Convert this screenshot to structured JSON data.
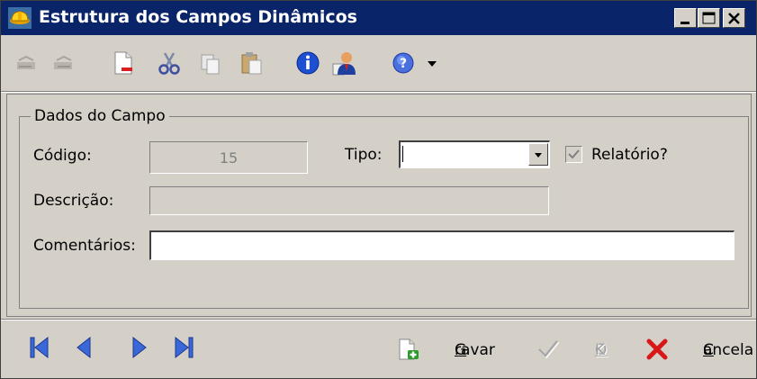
{
  "window": {
    "title": "Estrutura dos Campos Dinâmicos",
    "min_label": "minimize",
    "max_label": "maximize",
    "close_label": "close"
  },
  "toolbar": {
    "icons": [
      "undo-icon",
      "redo-icon",
      "new-document-icon",
      "cut-icon",
      "copy-icon",
      "paste-icon",
      "info-icon",
      "user-icon",
      "help-icon",
      "dropdown-arrow-icon"
    ]
  },
  "group": {
    "legend": "Dados do Campo"
  },
  "form": {
    "codigo_label": "Código:",
    "codigo_value": "15",
    "tipo_label": "Tipo:",
    "tipo_value": "",
    "relatorio_label": "Relatório?",
    "relatorio_checked": true,
    "descricao_label": "Descrição:",
    "descricao_value": "",
    "comentarios_label": "Comentários:",
    "comentarios_value": ""
  },
  "actions": {
    "gravar_first": "G",
    "gravar_rest": "ravar",
    "ok_first": "O",
    "ok_rest": "K",
    "cancela_first": "C",
    "cancela_rest": "ancela"
  },
  "colors": {
    "titlebar": "#0a246a",
    "face": "#d4d0c8",
    "nav_blue": "#3a68d8",
    "cancel_red": "#d81818"
  }
}
